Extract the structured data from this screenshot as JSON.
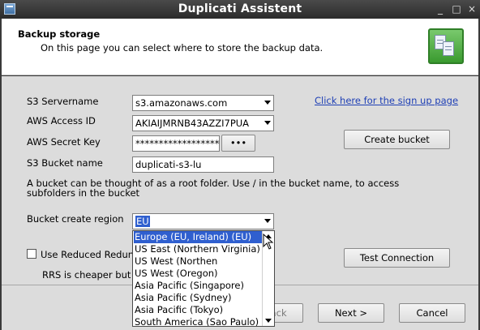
{
  "window": {
    "title": "Duplicati Assistent",
    "controls": [
      "_",
      "□",
      "×"
    ]
  },
  "header": {
    "title": "Backup storage",
    "description": "On this page you can select where to store the backup data.",
    "icon": "storage-documents-icon"
  },
  "form": {
    "servername_label": "S3 Servername",
    "servername_value": "s3.amazonaws.com",
    "access_id_label": "AWS Access ID",
    "access_id_value": "AKIAIJMRNB43AZZI7PUA",
    "secret_key_label": "AWS Secret Key",
    "secret_key_value": "******************",
    "secret_reveal_label": "•••",
    "bucket_name_label": "S3 Bucket name",
    "bucket_name_value": "duplicati-s3-lu",
    "bucket_hint": "A bucket can be thought of as a root folder. Use / in the bucket name, to access subfolders in the bucket",
    "bucket_region_label": "Bucket create region",
    "bucket_region_value": "EU",
    "rrs_label": "Use Reduced Redun",
    "rrs_hint": "RRS is cheaper but",
    "signup_link": "Click here for the sign up page",
    "create_bucket_label": "Create bucket",
    "test_connection_label": "Test Connection"
  },
  "region_options": [
    "Europe (EU, Ireland) (EU)",
    "US East (Northern Virginia)",
    "US West (Northen",
    "US West (Oregon)",
    "Asia Pacific (Singapore)",
    "Asia Pacific (Sydney)",
    "Asia Pacific (Tokyo)",
    "South America (Sao Paulo)"
  ],
  "footer": {
    "back_label": "< Back",
    "next_label": "Next >",
    "cancel_label": "Cancel"
  },
  "colors": {
    "selection": "#2f5fcf",
    "link": "#1e3fb5",
    "titlebar": "#2b2b2b"
  }
}
